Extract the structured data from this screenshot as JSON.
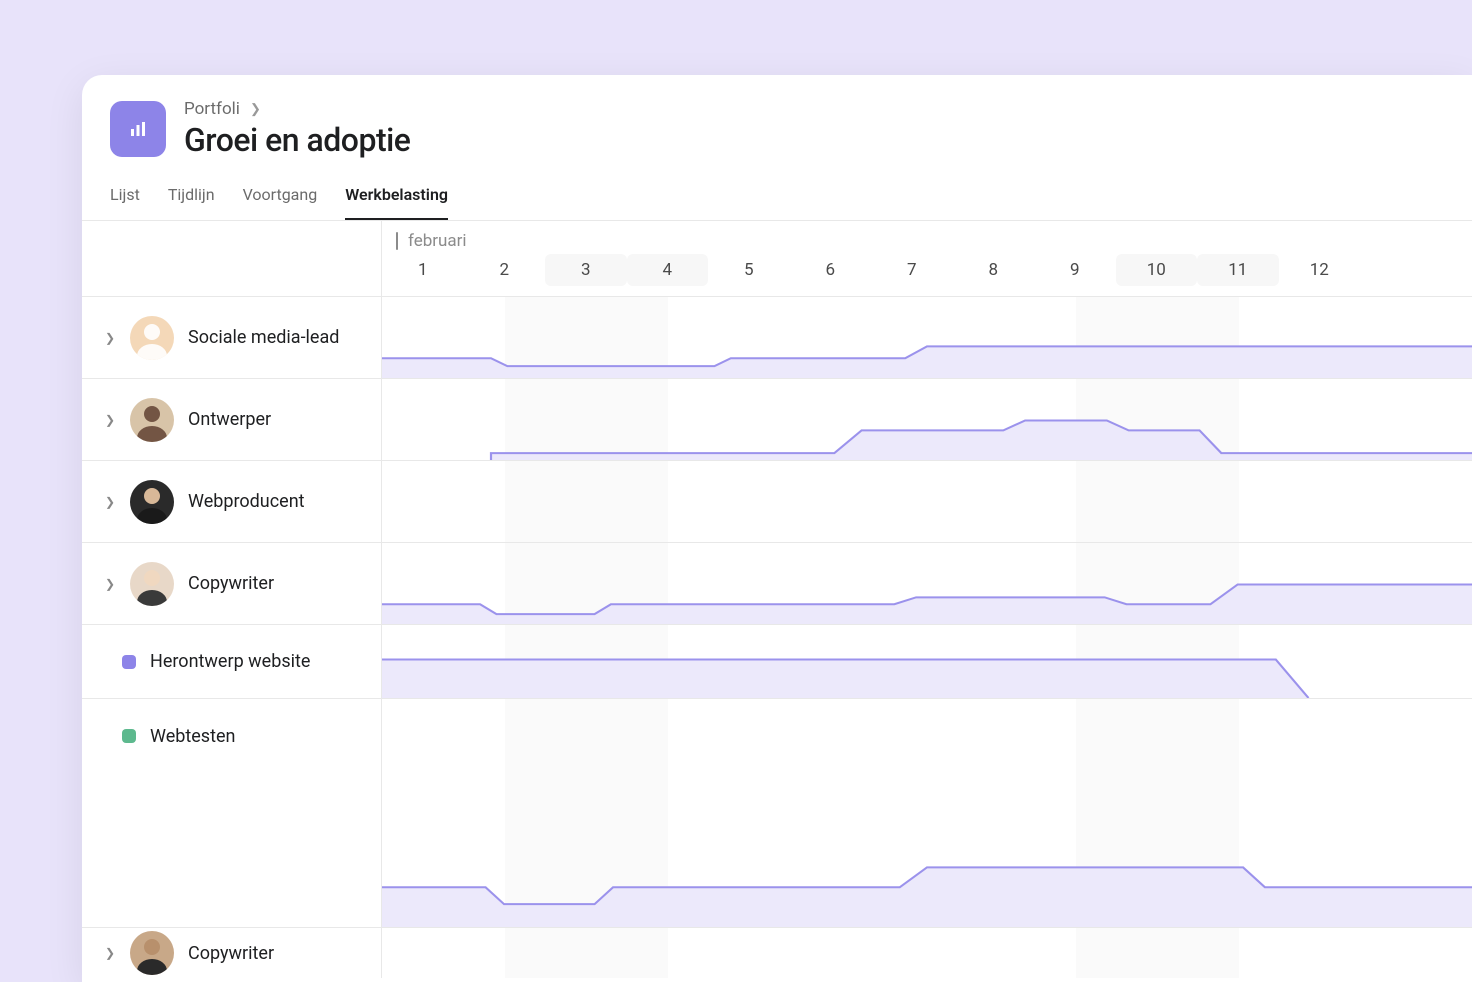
{
  "breadcrumb": {
    "parent": "Portfoli"
  },
  "page_title": "Groei en adoptie",
  "tabs": [
    {
      "label": "Lijst",
      "active": false
    },
    {
      "label": "Tijdlijn",
      "active": false
    },
    {
      "label": "Voortgang",
      "active": false
    },
    {
      "label": "Werkbelasting",
      "active": true
    }
  ],
  "timeline": {
    "month": "februari",
    "days": [
      {
        "n": "1",
        "weekend": false
      },
      {
        "n": "2",
        "weekend": false
      },
      {
        "n": "3",
        "weekend": true
      },
      {
        "n": "4",
        "weekend": true
      },
      {
        "n": "5",
        "weekend": false
      },
      {
        "n": "6",
        "weekend": false
      },
      {
        "n": "7",
        "weekend": false
      },
      {
        "n": "8",
        "weekend": false
      },
      {
        "n": "9",
        "weekend": false
      },
      {
        "n": "10",
        "weekend": true
      },
      {
        "n": "11",
        "weekend": true
      },
      {
        "n": "12",
        "weekend": false
      }
    ]
  },
  "rows": [
    {
      "name": "Sociale media-lead",
      "avatar_bg": "#F4D8B8"
    },
    {
      "name": "Ontwerper",
      "avatar_bg": "#D8C4A8"
    },
    {
      "name": "Webproducent",
      "avatar_bg": "#2A2A2A"
    },
    {
      "name": "Copywriter",
      "avatar_bg": "#E8D8C8"
    }
  ],
  "sub_rows": [
    {
      "name": "Herontwerp website",
      "color": "#8D84E8"
    },
    {
      "name": "Webtesten",
      "color": "#5DB98E"
    }
  ],
  "last_row": {
    "name": "Copywriter",
    "avatar_bg": "#C8A888"
  },
  "colors": {
    "line": "#9B92EC",
    "fill": "#ECE9FB"
  }
}
